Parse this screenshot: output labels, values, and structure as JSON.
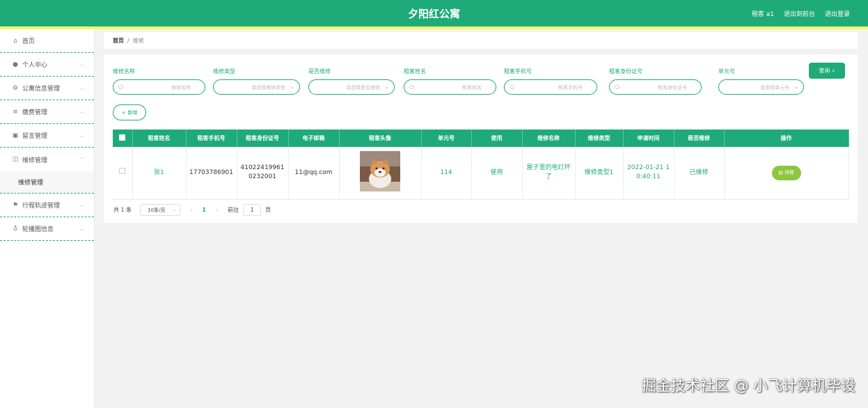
{
  "header": {
    "title": "夕阳红公寓",
    "user": "租客 a1",
    "back_link": "退出到前台",
    "logout": "退出登录"
  },
  "sidebar": {
    "items": [
      {
        "label": "首页",
        "icon": "home-icon"
      },
      {
        "label": "个人中心",
        "icon": "user-icon"
      },
      {
        "label": "公寓信息管理",
        "icon": "settings-icon"
      },
      {
        "label": "缴费管理",
        "icon": "list-icon"
      },
      {
        "label": "留言管理",
        "icon": "trash-icon"
      },
      {
        "label": "维修管理",
        "icon": "copy-icon"
      },
      {
        "label": "行程轨迹管理",
        "icon": "flag-icon"
      },
      {
        "label": "轮播图信息",
        "icon": "mic-icon"
      }
    ],
    "submenu": {
      "label": "维修管理"
    }
  },
  "breadcrumb": {
    "home": "首页",
    "separator": "/",
    "current": "维修"
  },
  "search": {
    "fields": [
      {
        "label": "维修名称",
        "placeholder": "维修名称"
      },
      {
        "label": "维修类型",
        "placeholder": "请选择维修类型"
      },
      {
        "label": "是否维修",
        "placeholder": "请选择是否维修"
      },
      {
        "label": "租客姓名",
        "placeholder": "租客姓名"
      },
      {
        "label": "租客手机号",
        "placeholder": "租客手机号"
      },
      {
        "label": "租客身份证号",
        "placeholder": "租客身份证号"
      },
      {
        "label": "单元号",
        "placeholder": "请选择单元号"
      }
    ],
    "query_button": "查询",
    "add_button": "新增"
  },
  "table": {
    "headers": [
      "租客姓名",
      "租客手机号",
      "租客身份证号",
      "电子邮箱",
      "租客头像",
      "单元号",
      "使用",
      "维修名称",
      "维修类型",
      "申请时间",
      "是否维修",
      "操作"
    ],
    "rows": [
      {
        "name": "张1",
        "phone": "17703786901",
        "id_card": "410224199610232001",
        "email": "11@qq.com",
        "avatar": "shiba-dog-photo",
        "unit": "114",
        "usage": "使用",
        "repair_name": "屋子里的电灯坏了",
        "repair_type": "维修类型1",
        "apply_time": "2022-01-21 10:40:11",
        "repaired": "已维修",
        "action": "详情"
      }
    ]
  },
  "pagination": {
    "total": "共 1 条",
    "page_size": "10条/页",
    "current_page": "1",
    "goto_label": "前往",
    "goto_value": "1",
    "page_unit": "页"
  },
  "watermark": "掘金技术社区 @ 小飞计算机毕设",
  "colors": {
    "primary": "#1eaa79",
    "accent_line": "#f8f36b",
    "detail_button": "#8dc63f"
  }
}
